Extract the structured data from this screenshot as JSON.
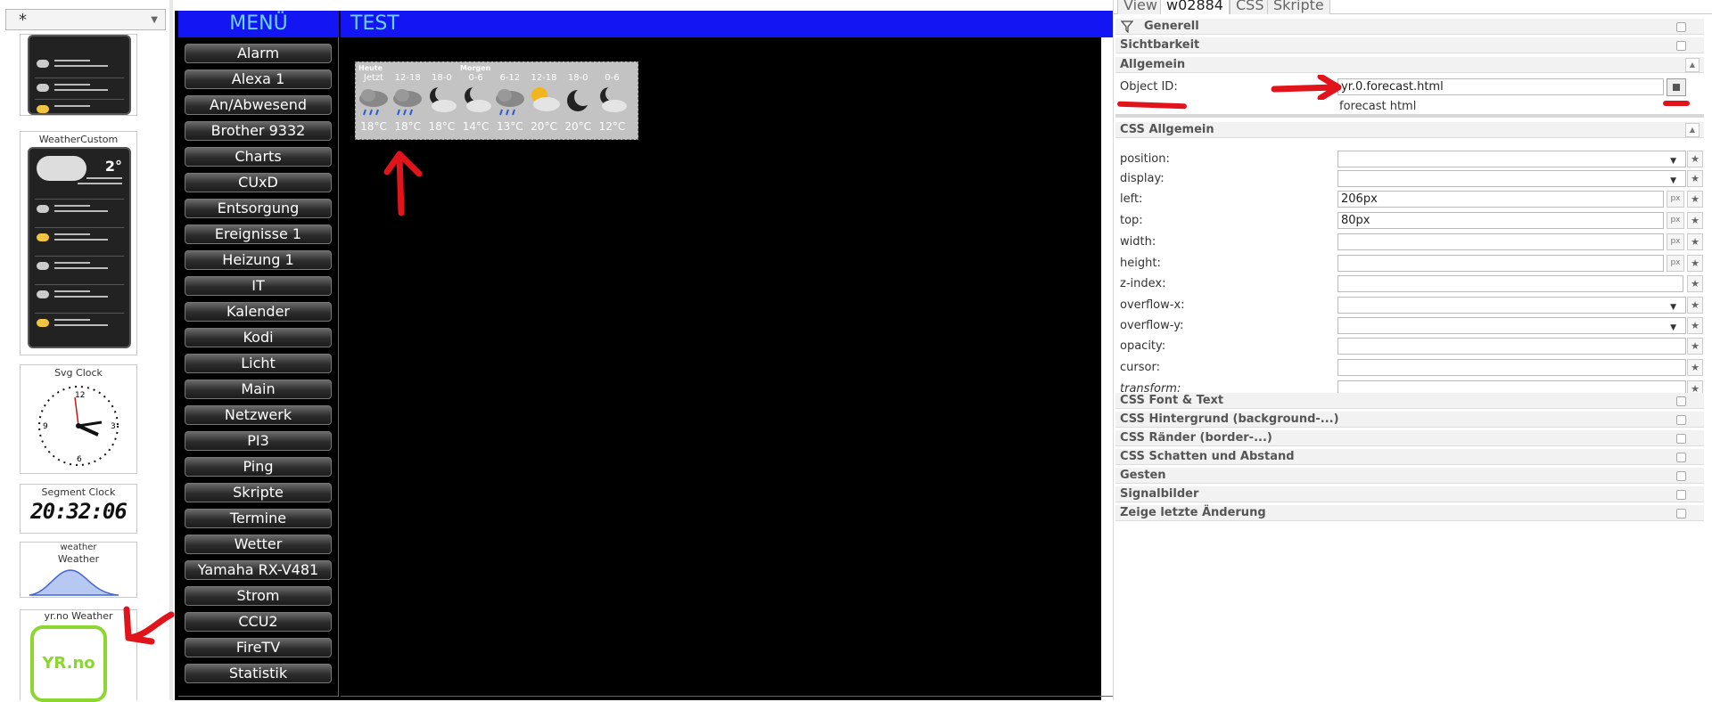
{
  "palette": {
    "selector_value": "*",
    "widgets": [
      {
        "title": "WeatherCustom"
      },
      {
        "title": "Svg Clock"
      },
      {
        "title": "Segment Clock",
        "clock_time": "20:32:06"
      },
      {
        "title": "weather",
        "subtitle": "Weather"
      },
      {
        "title": "yr.no Weather",
        "logo": "YR.no"
      }
    ]
  },
  "canvas": {
    "menu_title": "MENÜ",
    "view_title": "TEST",
    "menu_items": [
      "Alarm",
      "Alexa 1",
      "An/Abwesend",
      "Brother 9332",
      "Charts",
      "CUxD",
      "Entsorgung",
      "Ereignisse 1",
      "Heizung 1",
      "IT",
      "Kalender",
      "Kodi",
      "Licht",
      "Main",
      "Netzwerk",
      "PI3",
      "Ping",
      "Skripte",
      "Termine",
      "Wetter",
      "Yamaha RX-V481",
      "Strom",
      "CCU2",
      "FireTV",
      "Statistik"
    ],
    "forecast": {
      "today_label": "Heute",
      "tomorrow_label": "Morgen",
      "slots": [
        {
          "time": "Jetzt",
          "temp": "18°C",
          "icon": "rain-cloud-icon"
        },
        {
          "time": "12-18",
          "temp": "18°C",
          "icon": "rain-cloud-icon"
        },
        {
          "time": "18-0",
          "temp": "18°C",
          "icon": "moon-cloud-icon"
        },
        {
          "time": "0-6",
          "temp": "14°C",
          "icon": "moon-cloud-icon"
        },
        {
          "time": "6-12",
          "temp": "13°C",
          "icon": "rain-cloud-icon"
        },
        {
          "time": "12-18",
          "temp": "20°C",
          "icon": "sun-cloud-icon"
        },
        {
          "time": "18-0",
          "temp": "20°C",
          "icon": "moon-icon"
        },
        {
          "time": "0-6",
          "temp": "12°C",
          "icon": "moon-cloud-icon"
        }
      ]
    }
  },
  "inspector": {
    "tabs": [
      "View",
      "w02884",
      "CSS",
      "Skripte"
    ],
    "sections_top": [
      "Generell",
      "Sichtbarkeit",
      "Allgemein"
    ],
    "object_id_label": "Object ID:",
    "object_id_value": "yr.0.forecast.html",
    "object_id_hint": "forecast html",
    "css_section": "CSS Allgemein",
    "props": [
      {
        "label": "position:",
        "value": "",
        "kind": "dropdown"
      },
      {
        "label": "display:",
        "value": "",
        "kind": "dropdown"
      },
      {
        "label": "left:",
        "value": "206px",
        "kind": "px"
      },
      {
        "label": "top:",
        "value": "80px",
        "kind": "px"
      },
      {
        "label": "width:",
        "value": "",
        "kind": "px"
      },
      {
        "label": "height:",
        "value": "",
        "kind": "px"
      },
      {
        "label": "z-index:",
        "value": "",
        "kind": "spin"
      },
      {
        "label": "overflow-x:",
        "value": "",
        "kind": "dropdown"
      },
      {
        "label": "overflow-y:",
        "value": "",
        "kind": "dropdown"
      },
      {
        "label": "opacity:",
        "value": "",
        "kind": "text"
      },
      {
        "label": "cursor:",
        "value": "",
        "kind": "text"
      },
      {
        "label": "transform:",
        "value": "",
        "kind": "text"
      }
    ],
    "sections_bottom": [
      "CSS Font & Text",
      "CSS Hintergrund (background-...)",
      "CSS Ränder (border-...)",
      "CSS Schatten und Abstand",
      "Gesten",
      "Signalbilder",
      "Zeige letzte Änderung"
    ]
  },
  "colors": {
    "header_blue": "#1316f2",
    "header_text": "#6fd1ff",
    "annotation_red": "#e1141b",
    "yr_green": "#8bd630"
  }
}
